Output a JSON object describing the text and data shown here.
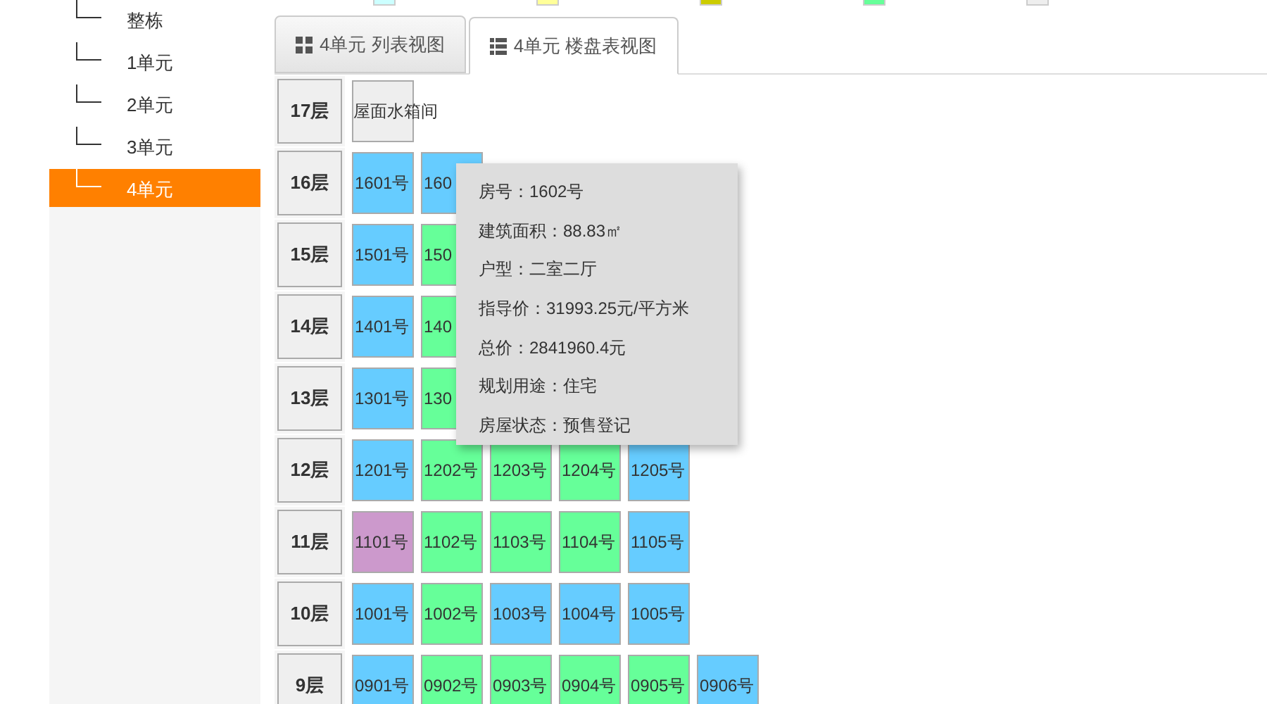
{
  "legend": [
    {
      "color": "#ccffff"
    },
    {
      "color": "#ffff99"
    },
    {
      "color": "#cccc00"
    },
    {
      "color": "#66ff99"
    },
    {
      "color": "#eeeeee"
    }
  ],
  "sidebar": {
    "items": [
      {
        "label": "整栋",
        "selected": false
      },
      {
        "label": "1单元",
        "selected": false
      },
      {
        "label": "2单元",
        "selected": false
      },
      {
        "label": "3单元",
        "selected": false
      },
      {
        "label": "4单元",
        "selected": true
      }
    ]
  },
  "tabs": [
    {
      "label": "4单元 列表视图",
      "selected": false,
      "kind": "grid"
    },
    {
      "label": "4单元 楼盘表视图",
      "selected": true,
      "kind": "list"
    }
  ],
  "floors": [
    {
      "label": "17层",
      "kind": "roof",
      "units": [
        {
          "label": "屋面水箱间",
          "color": "#eeeeee"
        }
      ]
    },
    {
      "label": "16层",
      "kind": "rooms",
      "units": [
        {
          "label": "1601号",
          "color": "#66ccff"
        },
        {
          "label": "160",
          "color": "#66ccff"
        }
      ]
    },
    {
      "label": "15层",
      "kind": "rooms",
      "units": [
        {
          "label": "1501号",
          "color": "#66ccff"
        },
        {
          "label": "150",
          "color": "#66ff99"
        }
      ]
    },
    {
      "label": "14层",
      "kind": "rooms",
      "units": [
        {
          "label": "1401号",
          "color": "#66ccff"
        },
        {
          "label": "140",
          "color": "#66ff99"
        }
      ]
    },
    {
      "label": "13层",
      "kind": "rooms",
      "units": [
        {
          "label": "1301号",
          "color": "#66ccff"
        },
        {
          "label": "130",
          "color": "#66ff99"
        }
      ]
    },
    {
      "label": "12层",
      "kind": "rooms",
      "units": [
        {
          "label": "1201号",
          "color": "#66ccff"
        },
        {
          "label": "1202号",
          "color": "#66ff99"
        },
        {
          "label": "1203号",
          "color": "#66ff99"
        },
        {
          "label": "1204号",
          "color": "#66ff99"
        },
        {
          "label": "1205号",
          "color": "#66ccff"
        }
      ]
    },
    {
      "label": "11层",
      "kind": "rooms",
      "units": [
        {
          "label": "1101号",
          "color": "#cc99cc"
        },
        {
          "label": "1102号",
          "color": "#66ff99"
        },
        {
          "label": "1103号",
          "color": "#66ff99"
        },
        {
          "label": "1104号",
          "color": "#66ff99"
        },
        {
          "label": "1105号",
          "color": "#66ccff"
        }
      ]
    },
    {
      "label": "10层",
      "kind": "rooms",
      "units": [
        {
          "label": "1001号",
          "color": "#66ccff"
        },
        {
          "label": "1002号",
          "color": "#66ff99"
        },
        {
          "label": "1003号",
          "color": "#66ccff"
        },
        {
          "label": "1004号",
          "color": "#66ccff"
        },
        {
          "label": "1005号",
          "color": "#66ccff"
        }
      ]
    },
    {
      "label": "9层",
      "kind": "rooms",
      "units": [
        {
          "label": "0901号",
          "color": "#66ccff"
        },
        {
          "label": "0902号",
          "color": "#66ff99"
        },
        {
          "label": "0903号",
          "color": "#66ff99"
        },
        {
          "label": "0904号",
          "color": "#66ff99"
        },
        {
          "label": "0905号",
          "color": "#66ff99"
        },
        {
          "label": "0906号",
          "color": "#66ccff"
        }
      ]
    }
  ],
  "tooltip": {
    "lines": [
      "房号：1602号",
      "建筑面积：88.83㎡",
      "户型：二室二厅",
      "指导价：31993.25元/平方米",
      "总价：2841960.4元",
      "规划用途：住宅",
      "房屋状态：预售登记"
    ]
  }
}
